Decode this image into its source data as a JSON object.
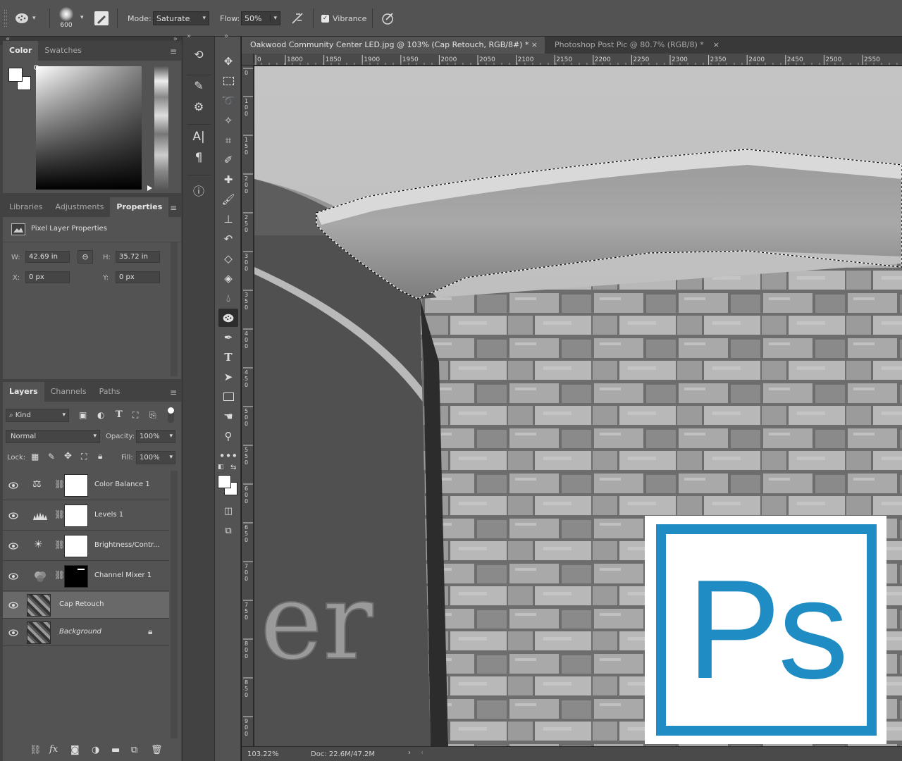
{
  "options_bar": {
    "brush_size": "600",
    "mode_label": "Mode:",
    "mode_value": "Saturate",
    "flow_label": "Flow:",
    "flow_value": "50%",
    "vibrance_label": "Vibrance",
    "vibrance_checked": true
  },
  "color_panel": {
    "tabs": [
      "Color",
      "Swatches"
    ],
    "active_tab": "Color"
  },
  "properties_panel": {
    "tabs": [
      "Libraries",
      "Adjustments",
      "Properties"
    ],
    "active_tab": "Properties",
    "header": "Pixel Layer Properties",
    "w_label": "W:",
    "w_value": "42.69 in",
    "h_label": "H:",
    "h_value": "35.72 in",
    "x_label": "X:",
    "x_value": "0 px",
    "y_label": "Y:",
    "y_value": "0 px"
  },
  "layers_panel": {
    "tabs": [
      "Layers",
      "Channels",
      "Paths"
    ],
    "active_tab": "Layers",
    "filter_kind": "Kind",
    "blend_mode": "Normal",
    "opacity_label": "Opacity:",
    "opacity_value": "100%",
    "lock_label": "Lock:",
    "fill_label": "Fill:",
    "fill_value": "100%",
    "layers": [
      {
        "name": "Color Balance 1",
        "icon": "balance-scale-icon",
        "thumb": "white"
      },
      {
        "name": "Levels 1",
        "icon": "histogram-icon",
        "thumb": "white"
      },
      {
        "name": "Brightness/Contr...",
        "icon": "sun-icon",
        "thumb": "white"
      },
      {
        "name": "Channel Mixer 1",
        "icon": "channel-mixer-icon",
        "thumb": "black"
      },
      {
        "name": "Cap Retouch",
        "icon": "",
        "thumb": "photo",
        "selected": true
      },
      {
        "name": "Background",
        "icon": "",
        "thumb": "photo",
        "locked": true
      }
    ]
  },
  "documents": {
    "tabs": [
      {
        "title": "Oakwood Community Center LED.jpg @ 103% (Cap Retouch, RGB/8#) *",
        "active": true
      },
      {
        "title": "Photoshop Post Pic @ 80.7% (RGB/8) *",
        "active": false
      }
    ],
    "ruler_h": [
      "0",
      "1800",
      "1850",
      "1900",
      "1950",
      "2000",
      "2050",
      "2100",
      "2150",
      "2200",
      "2250",
      "2300",
      "2350",
      "2400",
      "2450",
      "2500",
      "2550"
    ],
    "ruler_v": [
      "0",
      "1 0 0",
      "1 5 0",
      "2 0 0",
      "2 5 0",
      "3 0 0",
      "3 5 0",
      "4 0 0",
      "4 5 0",
      "5 0 0",
      "5 5 0",
      "6 0 0",
      "6 5 0",
      "7 0 0",
      "7 5 0",
      "8 0 0",
      "8 5 0",
      "9 0 0"
    ],
    "canvas_text": "er"
  },
  "status_bar": {
    "zoom": "103.22%",
    "doc_info": "Doc: 22.6M/47.2M"
  },
  "logo": {
    "text": "Ps",
    "color": "#1f8cc4"
  }
}
